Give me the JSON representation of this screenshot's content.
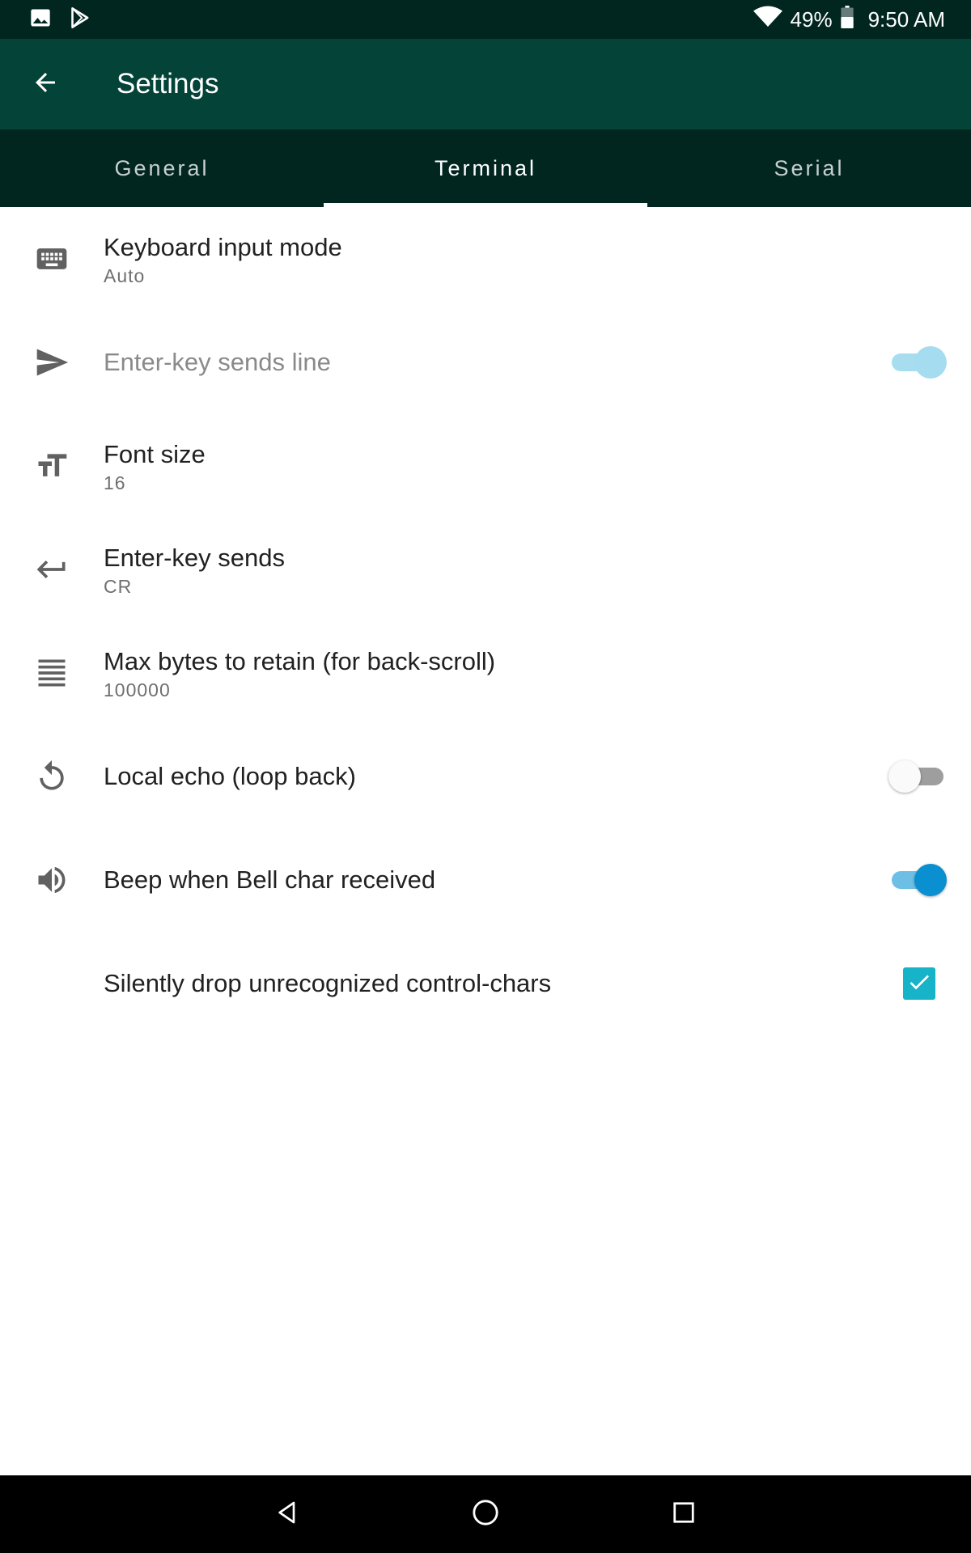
{
  "status_bar": {
    "battery": "49%",
    "time": "9:50 AM",
    "icons": [
      "image-icon",
      "play-store-icon",
      "wifi-icon",
      "battery-icon"
    ]
  },
  "app_bar": {
    "title": "Settings",
    "back_icon": "arrow-back-icon"
  },
  "tabs": [
    {
      "label": "General",
      "active": false
    },
    {
      "label": "Terminal",
      "active": true
    },
    {
      "label": "Serial",
      "active": false
    }
  ],
  "prefs": {
    "keyboard_input_mode": {
      "title": "Keyboard input mode",
      "summary": "Auto",
      "icon": "keyboard-icon"
    },
    "enter_key_sends_line": {
      "title": "Enter-key sends line",
      "enabled": false,
      "checked": true,
      "icon": "send-icon"
    },
    "font_size": {
      "title": "Font size",
      "summary": "16",
      "icon": "text-size-icon"
    },
    "enter_key_sends": {
      "title": "Enter-key sends",
      "summary": "CR",
      "icon": "keyboard-return-icon"
    },
    "max_bytes": {
      "title": "Max bytes to retain (for back-scroll)",
      "summary": "100000",
      "icon": "lines-icon"
    },
    "local_echo": {
      "title": "Local echo (loop back)",
      "checked": false,
      "icon": "refresh-icon"
    },
    "beep": {
      "title": "Beep when Bell char received",
      "checked": true,
      "icon": "volume-icon"
    },
    "silent_drop": {
      "title": "Silently drop unrecognized control-chars",
      "checked": true
    }
  },
  "colors": {
    "status_bar": "#012620",
    "app_bar": "#034338",
    "tab_bar": "#012620",
    "accent": "#0a8fd0",
    "checkbox": "#16b3c9"
  },
  "nav": {
    "icons": [
      "nav-back-icon",
      "nav-home-icon",
      "nav-recents-icon"
    ]
  }
}
